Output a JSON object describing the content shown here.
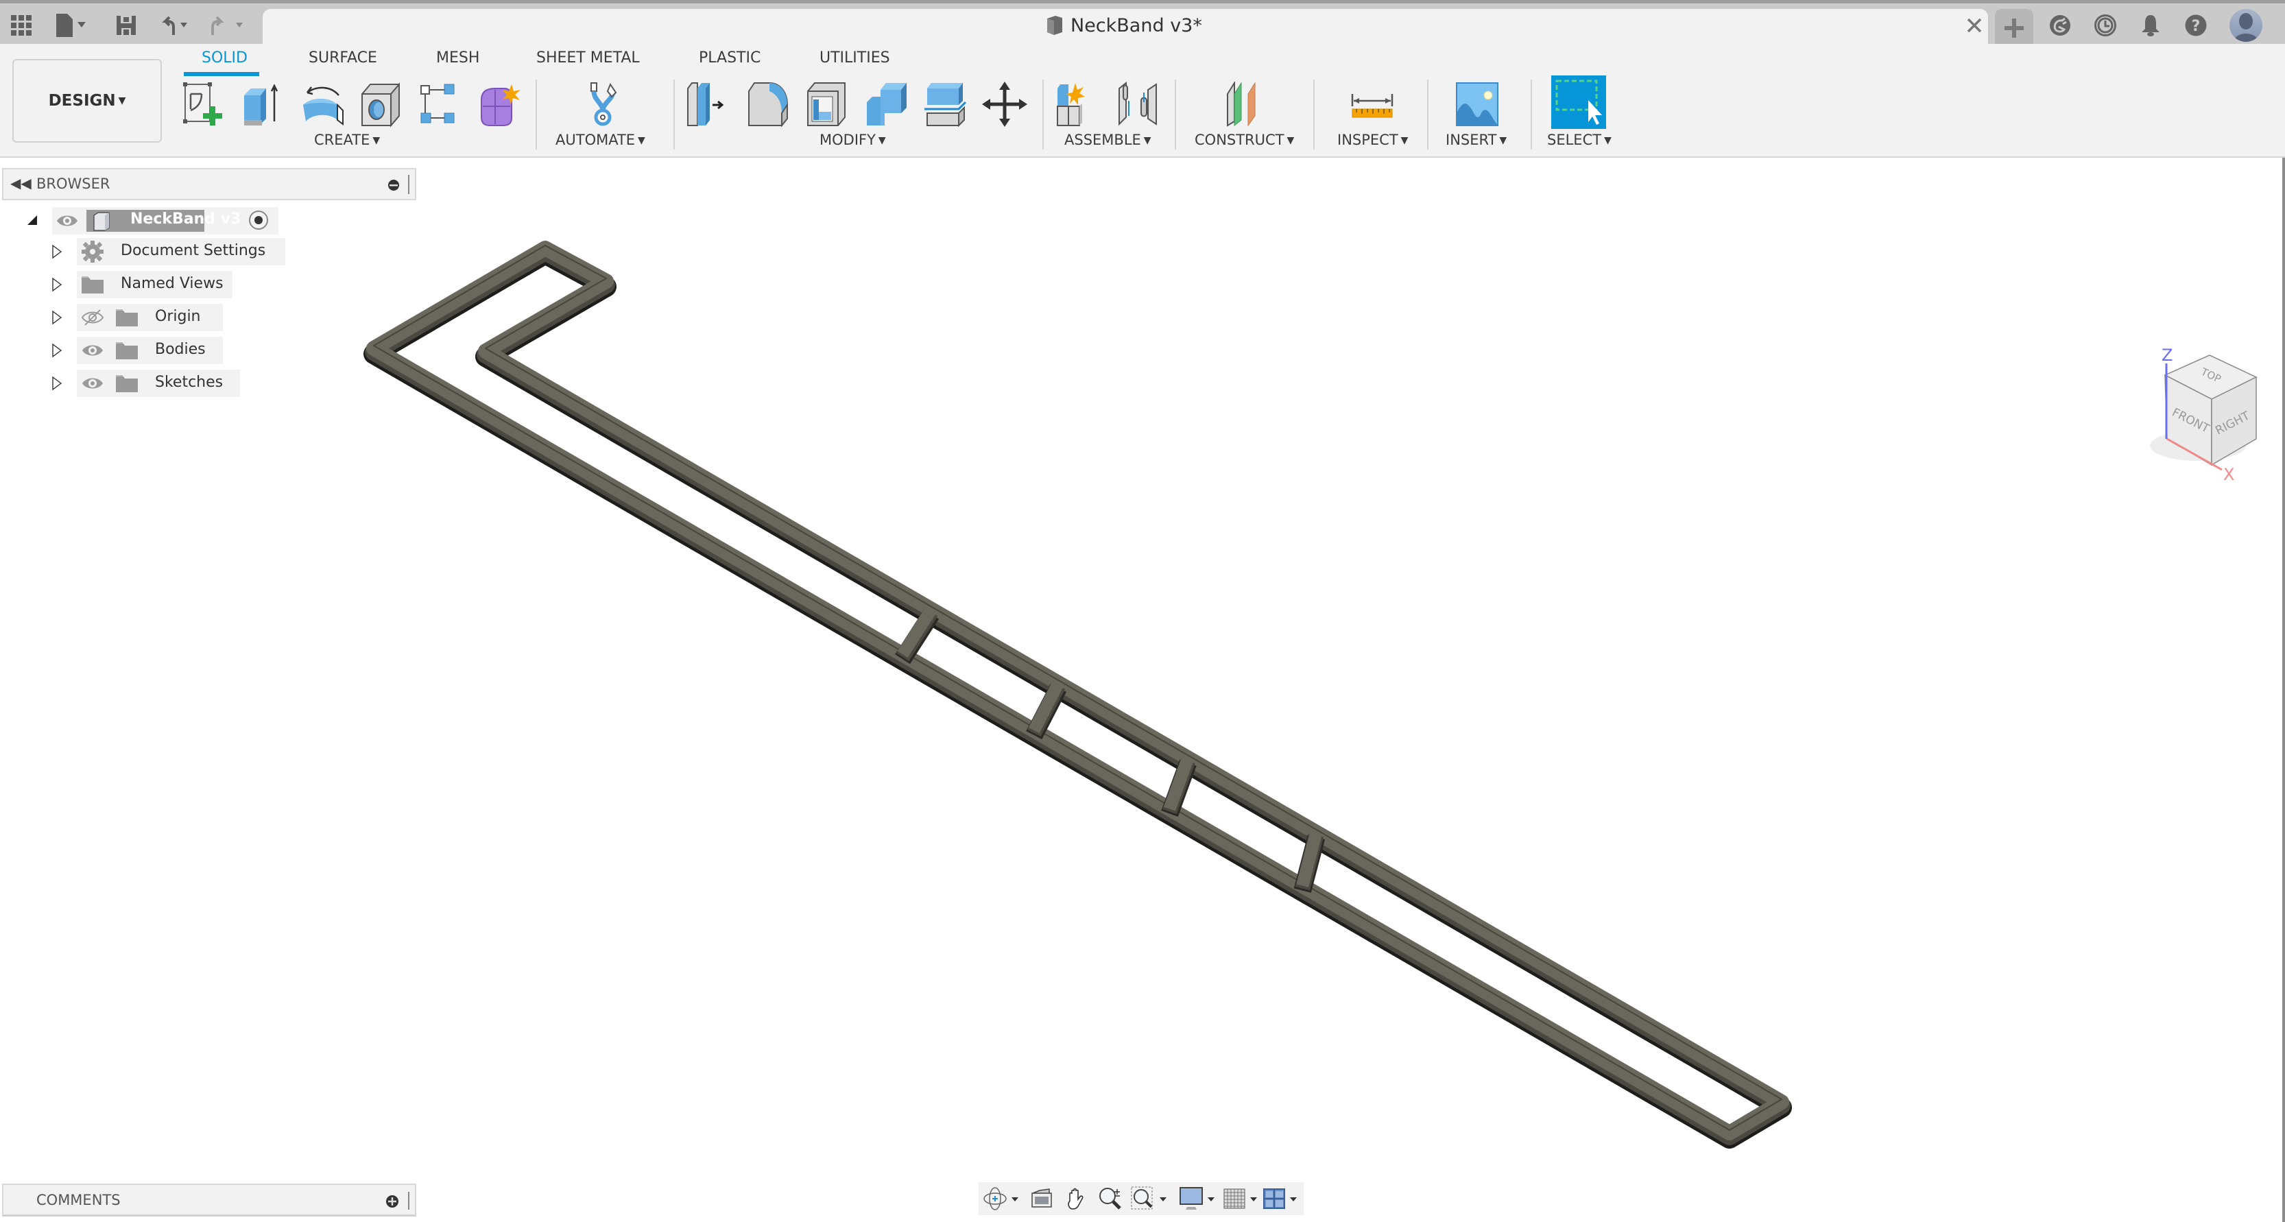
{
  "window": {
    "document_title": "NeckBand v3*",
    "accent_color": "#0696d7"
  },
  "titlebar": {
    "icons": [
      "apps-grid-icon",
      "file-icon",
      "save-icon",
      "undo-icon",
      "redo-icon"
    ],
    "right_icons": [
      "new-tab-plus-icon",
      "extensions-icon",
      "job-status-clock-icon",
      "notifications-bell-icon",
      "help-icon",
      "user-avatar"
    ]
  },
  "ribbon": {
    "workspace": "DESIGN",
    "tabs": [
      {
        "label": "SOLID",
        "active": true
      },
      {
        "label": "SURFACE",
        "active": false
      },
      {
        "label": "MESH",
        "active": false
      },
      {
        "label": "SHEET METAL",
        "active": false
      },
      {
        "label": "PLASTIC",
        "active": false
      },
      {
        "label": "UTILITIES",
        "active": false
      }
    ],
    "groups": {
      "create": "CREATE",
      "automate": "AUTOMATE",
      "modify": "MODIFY",
      "assemble": "ASSEMBLE",
      "construct": "CONSTRUCT",
      "inspect": "INSPECT",
      "insert": "INSERT",
      "select": "SELECT"
    },
    "tools": {
      "create": [
        "create-sketch-icon",
        "extrude-icon",
        "revolve-icon",
        "hole-icon",
        "pattern-icon",
        "form-icon"
      ],
      "automate": [
        "automate-icon"
      ],
      "modify": [
        "press-pull-icon",
        "fillet-icon",
        "shell-icon",
        "combine-icon",
        "split-body-icon",
        "move-icon"
      ],
      "assemble": [
        "new-component-icon",
        "joint-icon"
      ],
      "construct": [
        "offset-plane-icon"
      ],
      "inspect": [
        "measure-icon"
      ],
      "insert": [
        "insert-image-icon"
      ],
      "select": [
        "select-window-icon"
      ]
    }
  },
  "browser": {
    "title": "BROWSER",
    "root": {
      "label": "NeckBand v3"
    },
    "items": [
      {
        "label": "Document Settings",
        "icon": "gear-icon",
        "visibility": null
      },
      {
        "label": "Named Views",
        "icon": "folder-icon",
        "visibility": null
      },
      {
        "label": "Origin",
        "icon": "folder-icon",
        "visibility": "hidden"
      },
      {
        "label": "Bodies",
        "icon": "folder-icon",
        "visibility": "visible"
      },
      {
        "label": "Sketches",
        "icon": "folder-icon",
        "visibility": "visible"
      }
    ]
  },
  "comments": {
    "title": "COMMENTS"
  },
  "viewcube": {
    "faces": {
      "top": "TOP",
      "front": "FRONT",
      "right": "RIGHT"
    },
    "axes": {
      "z": "Z",
      "x": "X"
    }
  },
  "nav_toolbar": {
    "buttons": [
      "orbit-icon",
      "look-at-icon",
      "pan-hand-icon",
      "zoom-icon",
      "fit-window-zoom-icon",
      "display-settings-icon",
      "grid-snap-icon",
      "viewports-icon"
    ]
  }
}
